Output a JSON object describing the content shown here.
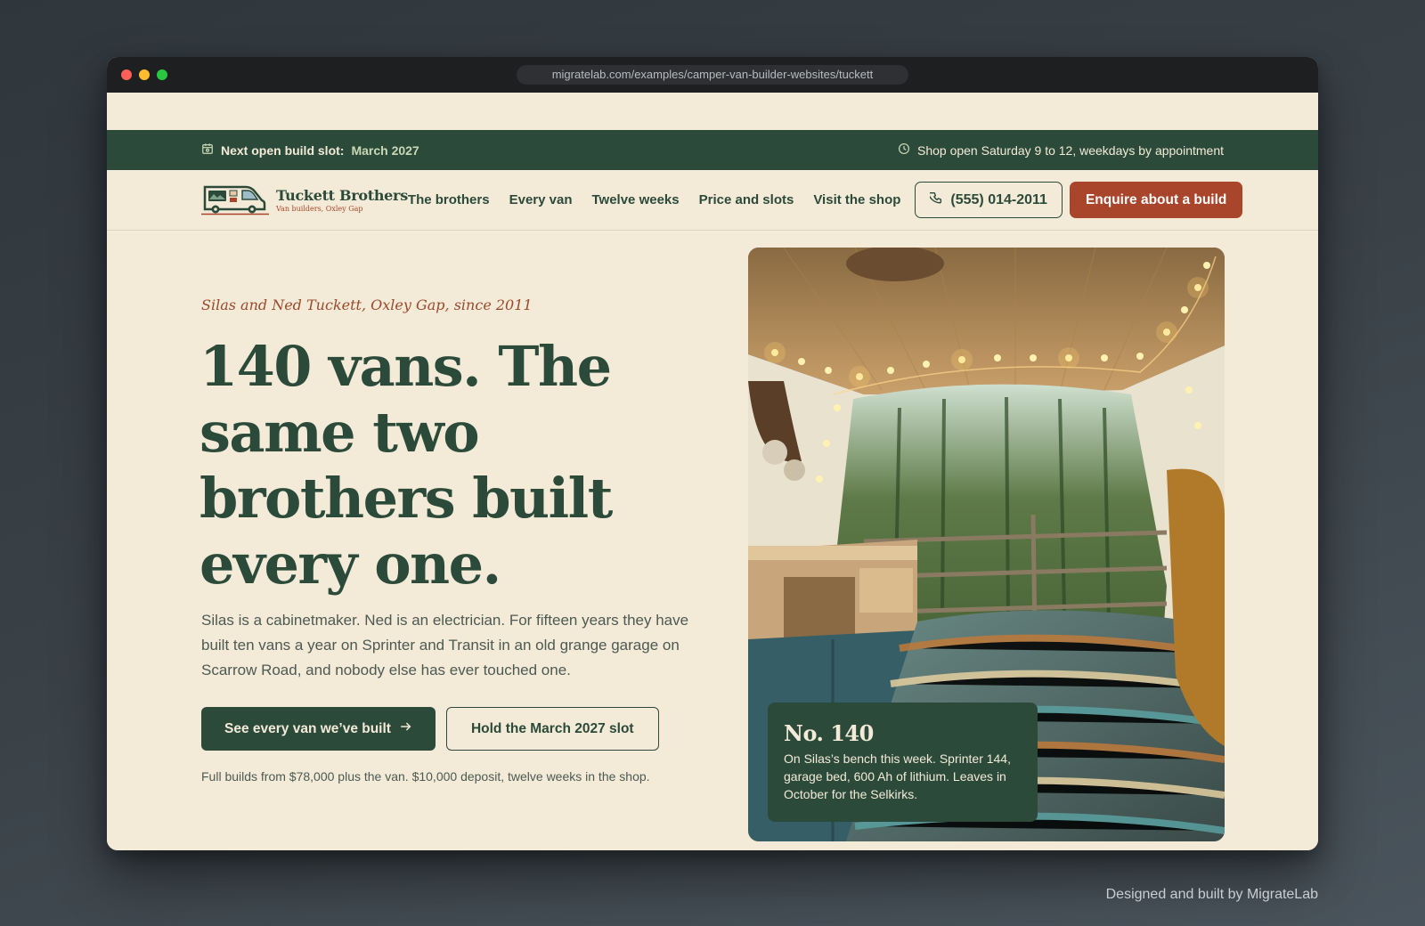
{
  "browser": {
    "url": "migratelab.com/examples/camper-van-builder-websites/tuckett"
  },
  "announce": {
    "slot_label": "Next open build slot:",
    "slot_date": "March 2027",
    "hours": "Shop open Saturday 9 to 12, weekdays by appointment"
  },
  "brand": {
    "name": "Tuckett Brothers",
    "tagline": "Van builders, Oxley Gap",
    "colors": {
      "green": "#2c4a3a",
      "rust": "#a9452a",
      "cream": "#f3ead8"
    }
  },
  "nav": {
    "items": [
      {
        "label": "The brothers"
      },
      {
        "label": "Every van"
      },
      {
        "label": "Twelve weeks"
      },
      {
        "label": "Price and slots"
      },
      {
        "label": "Visit the shop"
      }
    ],
    "phone": "(555) 014-2011",
    "enquire": "Enquire about a build"
  },
  "hero": {
    "eyebrow": "Silas and Ned Tuckett, Oxley Gap, since 2011",
    "headline": "140 vans. The same two brothers built every one.",
    "lede": "Silas is a cabinetmaker. Ned is an electrician. For fifteen years they have built ten vans a year on Sprinter and Transit in an old grange garage on Scarrow Road, and nobody else has ever touched one.",
    "cta_primary": "See every van we’ve built",
    "cta_secondary": "Hold the March 2027 slot",
    "fineprint": "Full builds from $78,000 plus the van. $10,000 deposit, twelve weeks in the shop."
  },
  "feature": {
    "number": "No. 140",
    "description": "On Silas’s bench this week. Sprinter 144, garage bed, 600 Ah of lithium. Leaves in October for the Selkirks."
  },
  "footer": {
    "credit": "Designed and built by MigrateLab"
  },
  "icons": {
    "calendar": "calendar-icon",
    "clock": "clock-icon",
    "phone": "phone-icon",
    "arrow": "arrow-right-icon"
  }
}
